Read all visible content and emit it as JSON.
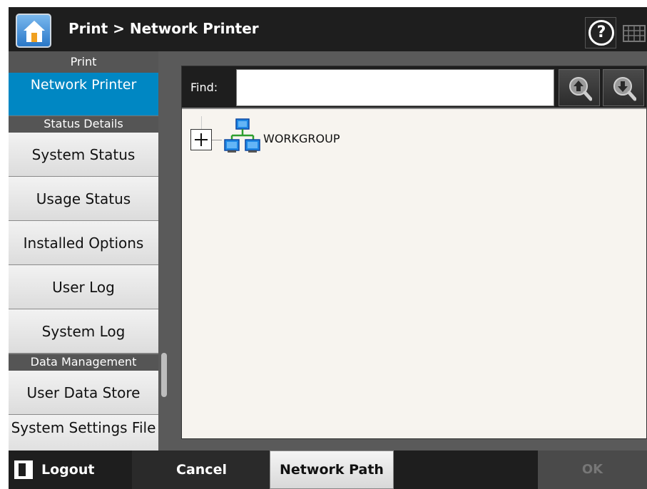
{
  "header": {
    "breadcrumb": "Print > Network Printer"
  },
  "icons": {
    "home": "home-icon",
    "help": "help-icon",
    "keyboard": "keyboard-icon",
    "search_up": "search-up-icon",
    "search_down": "search-down-icon",
    "network": "network-workgroup-icon",
    "logout": "logout-icon"
  },
  "sidebar": {
    "print_header": "Print",
    "active_item": "Network Printer",
    "status_header": "Status Details",
    "status_items": [
      "System Status",
      "Usage Status",
      "Installed Options",
      "User Log",
      "System Log"
    ],
    "data_header": "Data Management",
    "data_items": [
      "User Data Store",
      "System Settings File"
    ]
  },
  "find": {
    "label": "Find:",
    "value": ""
  },
  "tree": {
    "nodes": [
      {
        "label": "WORKGROUP",
        "expanded": false
      }
    ]
  },
  "footer": {
    "logout": "Logout",
    "cancel": "Cancel",
    "network_path": "Network Path",
    "ok": "OK"
  },
  "colors": {
    "accent": "#0087c3",
    "bar": "#1e1e1e",
    "sidebar": "#555555"
  }
}
